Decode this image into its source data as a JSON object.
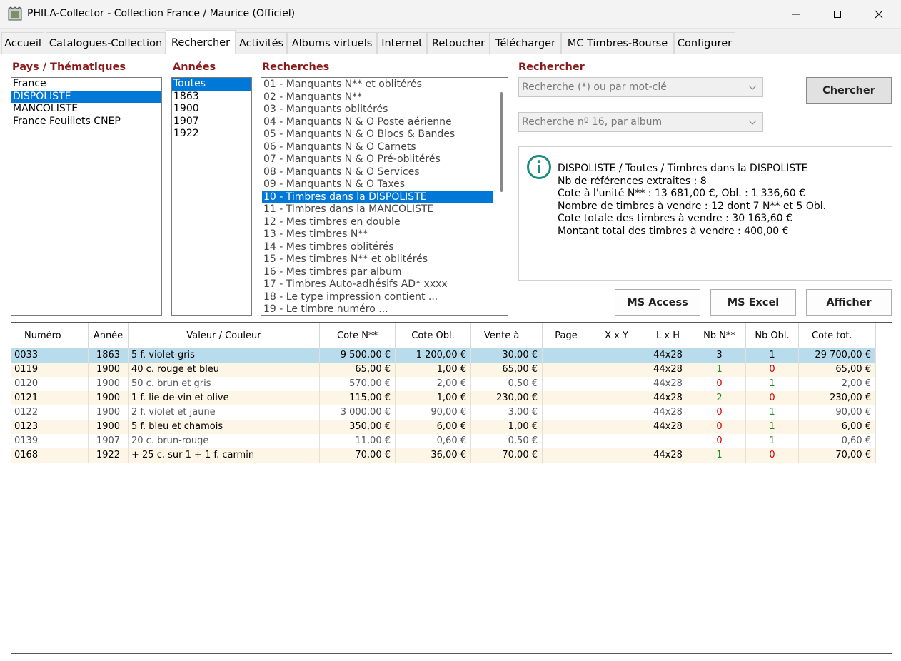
{
  "window": {
    "title": "PHILA-Collector - Collection France / Maurice (Officiel)"
  },
  "tabs": [
    {
      "label": "Accueil",
      "active": false
    },
    {
      "label": "Catalogues-Collection",
      "active": false
    },
    {
      "label": "Rechercher",
      "active": true
    },
    {
      "label": "Activités",
      "active": false
    },
    {
      "label": "Albums virtuels",
      "active": false
    },
    {
      "label": "Internet",
      "active": false
    },
    {
      "label": "Retoucher",
      "active": false
    },
    {
      "label": "Télécharger",
      "active": false
    },
    {
      "label": "MC Timbres-Bourse",
      "active": false
    },
    {
      "label": "Configurer",
      "active": false
    }
  ],
  "pays": {
    "label": "Pays / Thématiques",
    "items": [
      "France",
      "DISPOLISTE",
      "MANCOLISTE",
      "France Feuillets CNEP"
    ],
    "selected": 1
  },
  "annees": {
    "label": "Années",
    "items": [
      "Toutes",
      "1863",
      "1900",
      "1907",
      "1922"
    ],
    "selected": 0
  },
  "recherches": {
    "label": "Recherches",
    "items": [
      "01 - Manquants N** et oblitérés",
      "02 - Manquants N**",
      "03 - Manquants oblitérés",
      "04 - Manquants N & O Poste aérienne",
      "05 - Manquants N & O Blocs & Bandes",
      "06 - Manquants N & O Carnets",
      "07 - Manquants N & O Pré-oblitérés",
      "08 - Manquants N & O Services",
      "09 - Manquants N & O Taxes",
      "10 - Timbres dans la DISPOLISTE",
      "11 - Timbres dans la MANCOLISTE",
      "12 - Mes timbres en double",
      "13 - Mes timbres N**",
      "14 - Mes timbres oblitérés",
      "15 - Mes timbres N** et oblitérés",
      "16 - Mes timbres par album",
      "17 - Timbres Auto-adhésifs AD* xxxx",
      "18 - Le type impression contient ...",
      "19 - Le timbre numéro ..."
    ],
    "selected": 9
  },
  "rechercher": {
    "label": "Rechercher",
    "combo1": "Recherche (*) ou par mot-clé",
    "combo2": "Recherche nº 16, par album",
    "chercher_label": "Chercher"
  },
  "info": {
    "icon": "info-icon",
    "lines": [
      "DISPOLISTE / Toutes / Timbres dans la DISPOLISTE",
      "Nb de références extraites : 8",
      "Cote à l'unité N** : 13 681,00 €, Obl. : 1 336,60 €",
      "Nombre de timbres à vendre : 12 dont 7 N** et 5 Obl.",
      "Cote totale des timbres à vendre : 30 163,60 €",
      "Montant total des timbres à vendre : 400,00 €"
    ]
  },
  "actions": {
    "ms_access": "MS Access",
    "ms_excel": "MS Excel",
    "afficher": "Afficher"
  },
  "grid": {
    "columns": [
      "Numéro",
      "Année",
      "Valeur / Couleur",
      "Cote N**",
      "Cote Obl.",
      "Vente à",
      "Page",
      "X x Y",
      "L x H",
      "Nb N**",
      "Nb Obl.",
      "Cote tot."
    ],
    "rows": [
      [
        "0033",
        "1863",
        "5 f. violet-gris",
        "9 500,00 €",
        "1 200,00 €",
        "30,00 €",
        "",
        "",
        "44x28",
        "3",
        "1",
        "29 700,00 €"
      ],
      [
        "0119",
        "1900",
        "40 c. rouge et bleu",
        "65,00 €",
        "1,00 €",
        "65,00 €",
        "",
        "",
        "44x28",
        "1",
        "0",
        "65,00 €"
      ],
      [
        "0120",
        "1900",
        "50 c. brun et gris",
        "570,00 €",
        "2,00 €",
        "0,50 €",
        "",
        "",
        "44x28",
        "0",
        "1",
        "2,00 €"
      ],
      [
        "0121",
        "1900",
        "1 f. lie-de-vin et olive",
        "115,00 €",
        "1,00 €",
        "230,00 €",
        "",
        "",
        "44x28",
        "2",
        "0",
        "230,00 €"
      ],
      [
        "0122",
        "1900",
        "2 f. violet et jaune",
        "3 000,00 €",
        "90,00 €",
        "3,00 €",
        "",
        "",
        "44x28",
        "0",
        "1",
        "90,00 €"
      ],
      [
        "0123",
        "1900",
        "5 f. bleu et chamois",
        "350,00 €",
        "6,00 €",
        "1,00 €",
        "",
        "",
        "44x28",
        "0",
        "1",
        "6,00 €"
      ],
      [
        "0139",
        "1907",
        "20 c. brun-rouge",
        "11,00 €",
        "0,60 €",
        "0,50 €",
        "",
        "",
        "",
        "0",
        "1",
        "0,60 €"
      ],
      [
        "0168",
        "1922",
        "+ 25 c. sur 1 + 1 f. carmin",
        "70,00 €",
        "36,00 €",
        "70,00 €",
        "",
        "",
        "44x28",
        "1",
        "0",
        "70,00 €"
      ]
    ],
    "selected_row": 0
  },
  "colors": {
    "section_label": "#8b1a1a",
    "selection": "#0078d7",
    "row_selected": "#b9dcec",
    "row_alt": "#fdf5e6",
    "count_positive": "#1a8a1a",
    "count_zero": "#d00000"
  }
}
